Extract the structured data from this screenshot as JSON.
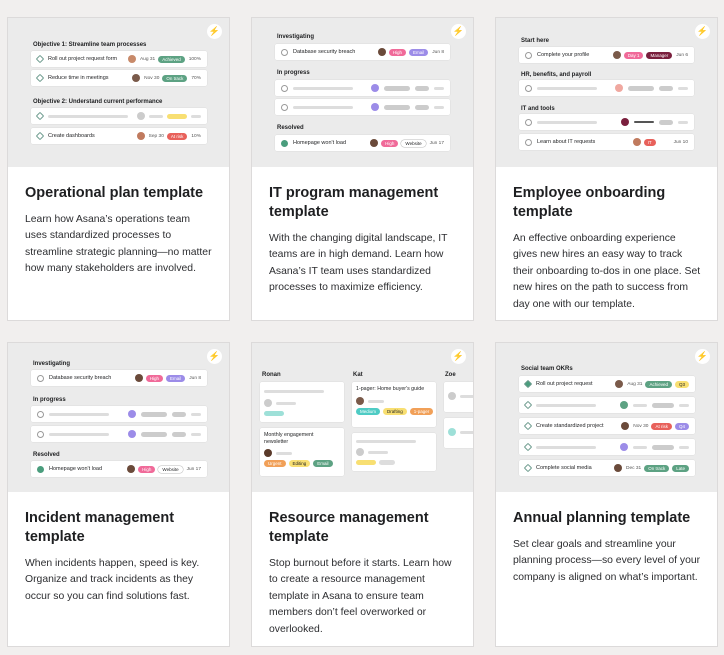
{
  "cards": [
    {
      "title": "Operational plan template",
      "desc": "Learn how Asana’s operations team uses standardized processes to streamline strategic planning—no matter how many stakeholders are involved."
    },
    {
      "title": "IT program management template",
      "desc": "With the changing digital landscape, IT teams are in high demand. Learn how Asana’s IT team uses standardized processes to maximize efficiency."
    },
    {
      "title": "Employee onboarding template",
      "desc": "An effective onboarding experience gives new hires an easy way to track their onboarding to-dos in one place. Set new hires on the path to success from day one with our template."
    },
    {
      "title": "Incident management template",
      "desc": "When incidents happen, speed is key. Organize and track incidents as they occur so you can find solutions fast."
    },
    {
      "title": "Resource management template",
      "desc": "Stop burnout before it starts. Learn how to create a resource management template in Asana to ensure team members don’t feel overworked or overlooked."
    },
    {
      "title": "Annual planning template",
      "desc": "Set clear goals and streamline your planning process—so every level of your company is aligned on what’s important."
    }
  ],
  "p1": {
    "obj1": "Objective 1: Streamline team processes",
    "r1": {
      "text": "Roll out project request form",
      "date": "Aug 31",
      "pill": "Achieved",
      "pct": "100%"
    },
    "r2": {
      "text": "Reduce time in meetings",
      "date": "Nov 30",
      "pill": "On track",
      "pct": "70%"
    },
    "obj2": "Objective 2: Understand current performance",
    "r4": {
      "text": "Create dashboards",
      "date": "Sep 30",
      "pill": "At risk",
      "pct": "10%"
    }
  },
  "p2": {
    "s1": "Investigating",
    "r1": {
      "text": "Database security breach",
      "p1": "High",
      "p2": "Email",
      "date": "Jun 8"
    },
    "s2": "In progress",
    "s3": "Resolved",
    "r4": {
      "text": "Homepage won't load",
      "p1": "High",
      "p2": "Website",
      "date": "Jun 17"
    }
  },
  "p3": {
    "s1": "Start here",
    "r1": {
      "text": "Complete your profile",
      "p1": "Day 1",
      "p2": "Manager",
      "date": "Jun 6"
    },
    "s2": "HR, benefits, and payroll",
    "s3": "IT and tools",
    "r4": {
      "text": "Learn about IT requests",
      "p1": "IT",
      "date": "Jun 10"
    }
  },
  "p4": {
    "s1": "Investigating",
    "r1": {
      "text": "Database security breach",
      "p1": "High",
      "p2": "Email",
      "date": "Jun 8"
    },
    "s2": "In progress",
    "s3": "Resolved",
    "r4": {
      "text": "Homepage won't load",
      "p1": "High",
      "p2": "Website",
      "date": "Jun 17"
    }
  },
  "p5": {
    "c1": "Ronan",
    "c2": "Kat",
    "c3": "Zoe",
    "k1": "1-pager: Home buyer's guide",
    "k1p": [
      "Medium",
      "Drafting",
      "1-pager"
    ],
    "k2": "Monthly engagement newsletter",
    "k2p": [
      "Urgent",
      "Editing",
      "Email"
    ]
  },
  "p6": {
    "s1": "Social team OKRs",
    "r1": {
      "text": "Roll out project request",
      "date": "Aug 31",
      "p1": "Achieved",
      "p2": "Q3"
    },
    "r3": {
      "text": "Create standardized project",
      "date": "Nov 30",
      "p1": "At risk",
      "p2": "Q4"
    },
    "r5": {
      "text": "Complete social media",
      "date": "Dec 31",
      "p1": "On track",
      "p2": "Late"
    }
  },
  "colors": {
    "green": "#5da283",
    "red": "#e8615b",
    "pink": "#f06a99",
    "purple": "#9c8ce8",
    "yellow": "#f8df72",
    "orange": "#f1a058",
    "maroon": "#7a1f3d",
    "teal": "#4ecbc4"
  }
}
